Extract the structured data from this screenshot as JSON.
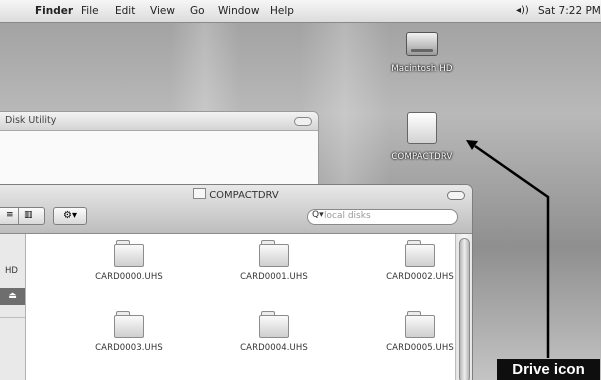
{
  "menubar": {
    "apple_glyph": "",
    "app_name": "Finder",
    "items": [
      "File",
      "Edit",
      "View",
      "Go",
      "Window",
      "Help"
    ],
    "volume_glyph": "◂))",
    "clock": "Sat 7:22 PM"
  },
  "desktop": {
    "icons": [
      {
        "label": "Macintosh HD",
        "icon": "hard-drive-icon"
      },
      {
        "label": "COMPACTDRV",
        "icon": "removable-drive-icon"
      }
    ]
  },
  "disk_utility_window": {
    "title": "Disk Utility"
  },
  "finder_window": {
    "title": "COMPACTDRV",
    "view_list_glyph": "≡",
    "view_column_glyph": "▥",
    "action_glyph": "⚙▾",
    "search": {
      "glyph": "Q▾",
      "placeholder": "local disks"
    },
    "sidebar": {
      "device_label": "HD",
      "eject_glyph": "⏏"
    },
    "files": [
      "CARD0000.UHS",
      "CARD0001.UHS",
      "CARD0002.UHS",
      "CARD0003.UHS",
      "CARD0004.UHS",
      "CARD0005.UHS"
    ]
  },
  "annotation": {
    "label": "Drive icon"
  }
}
